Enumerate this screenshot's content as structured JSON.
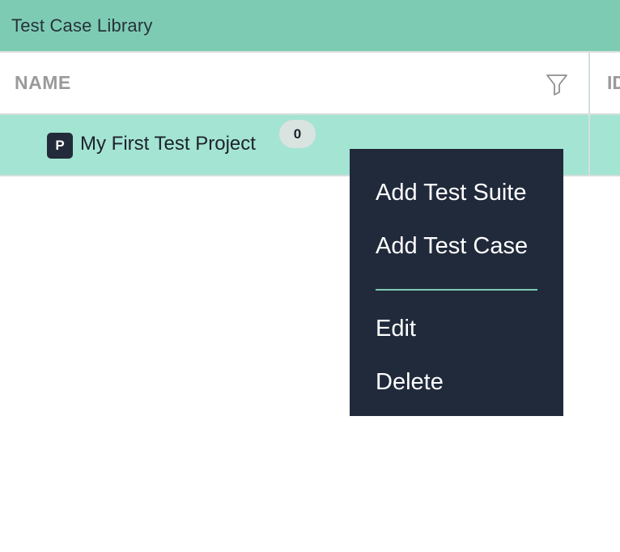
{
  "header": {
    "title": "Test Case Library"
  },
  "grid": {
    "columns": [
      {
        "label": "NAME"
      },
      {
        "label": "ID"
      }
    ],
    "rows": [
      {
        "type_badge": "P",
        "name": "My First Test Project",
        "count": "0"
      }
    ]
  },
  "context_menu": {
    "items": [
      {
        "label": "Add Test Suite"
      },
      {
        "label": "Add Test Case"
      },
      {
        "label": "Edit"
      },
      {
        "label": "Delete"
      }
    ]
  },
  "icons": {
    "filter": "filter-icon"
  },
  "colors": {
    "header_bg": "#7ecbb4",
    "row_selected_bg": "#a4e4d3",
    "menu_bg": "#212a3b",
    "menu_divider": "#7ecbb4",
    "badge_bg": "#232b3a",
    "count_pill_bg": "#d9e3e0",
    "column_label": "#9a9a9a"
  }
}
